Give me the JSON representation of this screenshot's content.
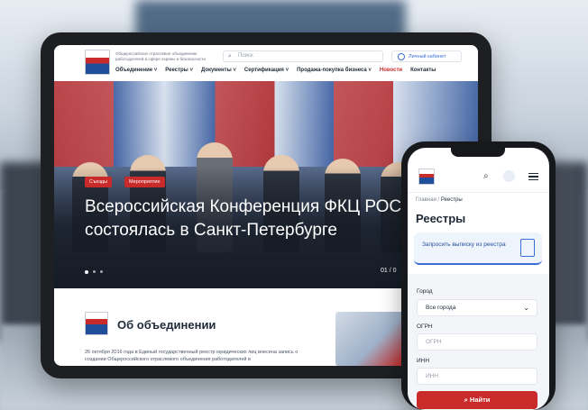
{
  "tablet": {
    "org_name": "Общероссийское отраслевое объединение работодателей в сфере охраны и безопасности",
    "search_placeholder": "Поиск",
    "cabinet_label": "Личный кабинет",
    "nav": [
      "Объединение ˅",
      "Реестры ˅",
      "Документы ˅",
      "Сертификация ˅",
      "Продажа-покупка бизнеса ˅",
      "Новости",
      "Контакты"
    ],
    "nav_active": "Новости",
    "hero": {
      "tags": [
        "Съезды",
        "Мероприятие"
      ],
      "title": "Всероссийская Конференция ФКЦ РОС состоялась в Санкт-Петербурге",
      "counter": "01 / 0"
    },
    "about": {
      "title": "Об объединении",
      "text": "26 октября 2016 года в Единый государственный реестр юридических лиц внесена запись о создании Общероссийского отраслевого объединения работодателей в"
    }
  },
  "phone": {
    "breadcrumb_home": "Главная",
    "breadcrumb_sep": "/",
    "breadcrumb_current": "Реестры",
    "title": "Реестры",
    "request_label": "Запросить выписку из реестра",
    "city_label": "Город",
    "city_value": "Все города",
    "ogrn_label": "ОГРН",
    "ogrn_placeholder": "ОГРН",
    "inn_label": "ИНН",
    "inn_placeholder": "ИНН",
    "find_button": "Найти"
  },
  "colors": {
    "brand_red": "#c92a2a",
    "brand_blue": "#3b6fd6",
    "text_dark": "#1f2a38"
  }
}
